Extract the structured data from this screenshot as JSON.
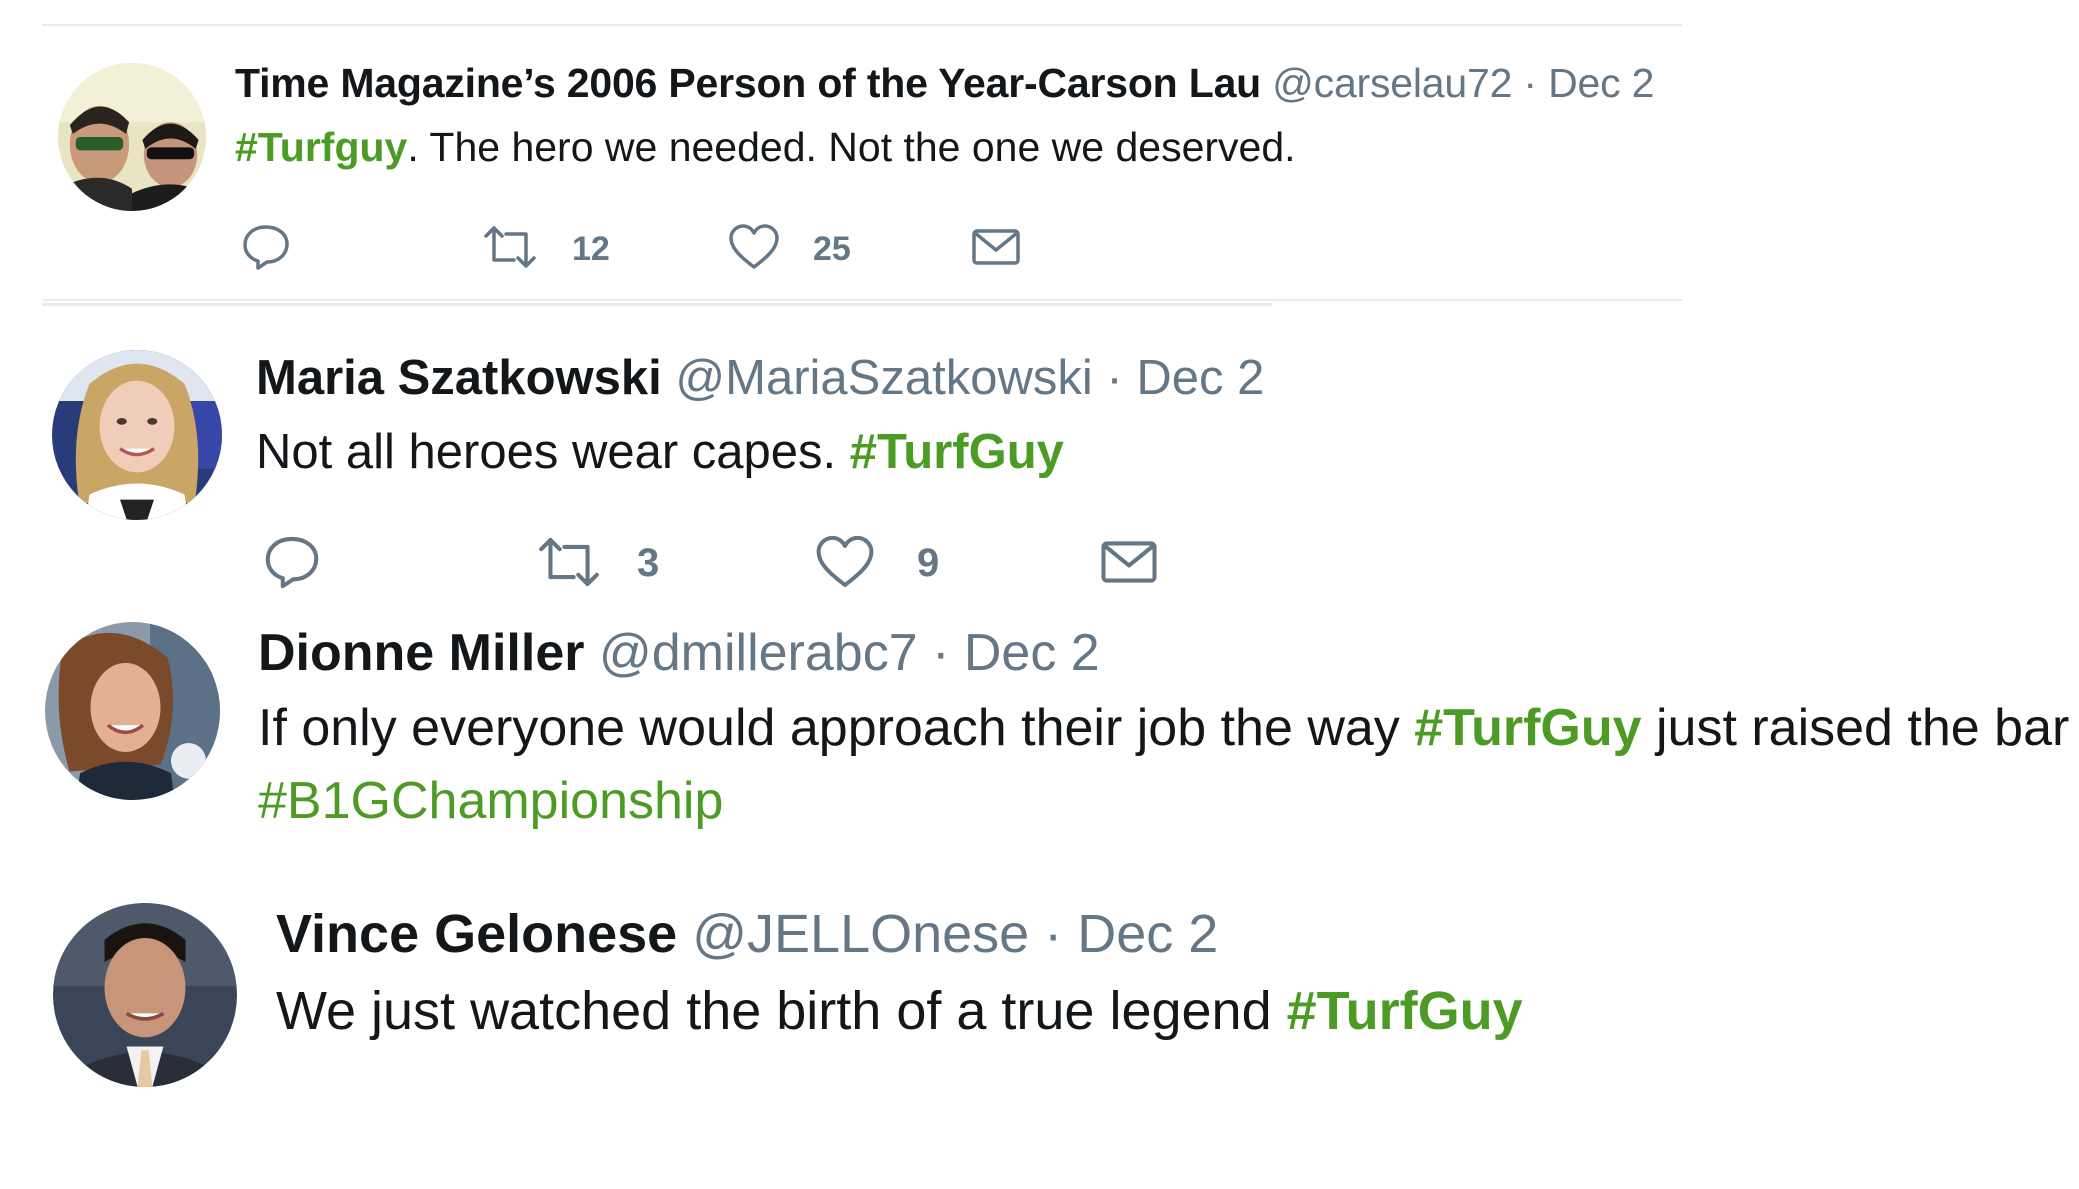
{
  "tweets": [
    {
      "name": "Time Magazine’s 2006 Person of the Year-Carson Lau",
      "handle": "@carselau72",
      "separator": "·",
      "date": "Dec 2",
      "hashtag": "#Turfguy",
      "text_after": ". The hero we needed. Not the one we deserved.",
      "reply_icon": "reply-icon",
      "retweet_icon": "retweet-icon",
      "like_icon": "heart-icon",
      "dm_icon": "envelope-icon",
      "retweet_count": "12",
      "like_count": "25"
    },
    {
      "name": "Maria Szatkowski",
      "handle": "@MariaSzatkowski",
      "separator": "·",
      "date": "Dec 2",
      "text_before": "Not all heroes wear capes. ",
      "hashtag": "#TurfGuy",
      "retweet_count": "3",
      "like_count": "9"
    },
    {
      "name": "Dionne Miller",
      "handle": "@dmillerabc7",
      "separator": "·",
      "date": "Dec 2",
      "text_before": "If only everyone would approach their job the way ",
      "hashtag": "#TurfGuy",
      "text_after": " just raised the bar",
      "hashtag2": "#B1GChampionship"
    },
    {
      "name": "Vince Gelonese",
      "handle": "@JELLOnese",
      "separator": "·",
      "date": "Dec 2",
      "text_before": "We just watched the birth of a true legend ",
      "hashtag": "#TurfGuy"
    }
  ],
  "colors": {
    "hashtag": "#4c9b24",
    "meta": "#657786",
    "name": "#14171a",
    "divider": "#e6ecf0"
  }
}
